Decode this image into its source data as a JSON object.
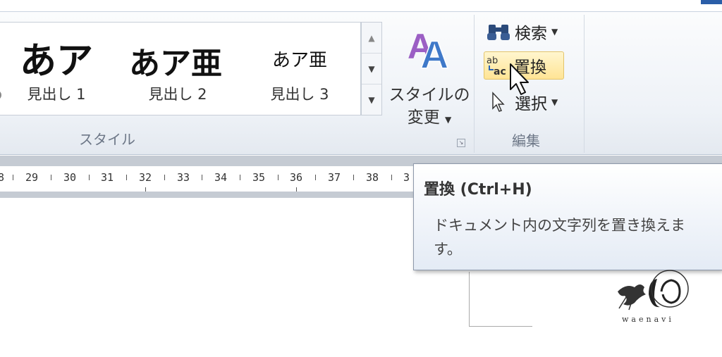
{
  "ribbon": {
    "styles_gallery": {
      "items": [
        {
          "sample": "あア",
          "label": "見出し 1"
        },
        {
          "sample": "あア亜",
          "label": "見出し 2"
        },
        {
          "sample": "あア亜",
          "label": "見出し 3"
        }
      ],
      "group_label": "スタイル"
    },
    "change_style": {
      "line1": "スタイルの",
      "line2": "変更",
      "icon": "style-letters-icon"
    },
    "editing": {
      "find_label": "検索",
      "replace_label": "置換",
      "select_label": "選択",
      "group_label": "編集"
    }
  },
  "ruler": {
    "numbers": [
      "8",
      "29",
      "30",
      "31",
      "32",
      "33",
      "34",
      "35",
      "36",
      "37",
      "38",
      "3"
    ]
  },
  "tooltip": {
    "title": "置換 (Ctrl+H)",
    "body": "ドキュメント内の文字列を置き換えます。"
  },
  "watermark": {
    "text": "waenavi"
  },
  "colors": {
    "highlight": "#ffe495",
    "accent": "#2a5ea8"
  }
}
